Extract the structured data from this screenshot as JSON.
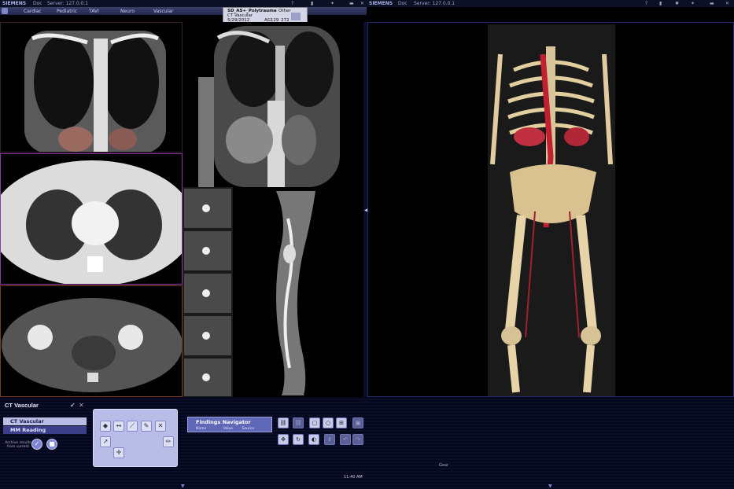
{
  "left_titlebar": {
    "brand": "SIEMENS",
    "user": "Doc",
    "server": "Server: 127.0.0.1"
  },
  "right_titlebar": {
    "brand": "SIEMENS",
    "user": "Doc",
    "server": "Server: 127.0.0.1"
  },
  "menu": {
    "items": [
      "Cardiac",
      "Pediatric",
      "TAVI",
      "Neuro",
      "Vascular"
    ]
  },
  "patient": {
    "name": "SD_AS+_Polytrauma",
    "other": "Other",
    "study": "CT Vascular",
    "date": "5/29/2012",
    "id": "AG129_272"
  },
  "viewports": {
    "orientation_r": "R"
  },
  "panel": {
    "title": "CT Vascular",
    "workflows": [
      "CT Vascular",
      "MM Reading"
    ],
    "archive_label": "Archive results\nfrom current"
  },
  "findings": {
    "title": "Findings Navigator",
    "col_name": "Name",
    "col_value": "Value",
    "col_source": "Source"
  },
  "status": {
    "time": "11:40 AM",
    "caption_right": "Gear"
  },
  "icons": [
    "cube-icon",
    "measure-icon",
    "ruler-icon",
    "marker-icon",
    "arrow-icon",
    "link-icon",
    "undo-icon",
    "redo-icon",
    "check-icon",
    "stop-icon"
  ]
}
